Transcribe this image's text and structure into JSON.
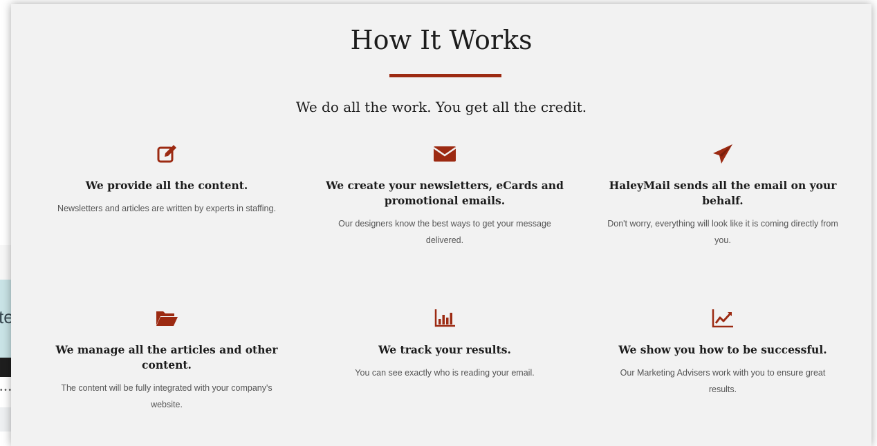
{
  "section": {
    "title": "How It Works",
    "subtitle": "We do all the work. You get all the credit."
  },
  "colors": {
    "accent": "#9c2a12",
    "panel_bg": "#f2f2f2",
    "text": "#1c1c1c"
  },
  "background_page": {
    "partial_text": "te"
  },
  "features": [
    {
      "icon": "edit-icon",
      "heading": "We provide all the content.",
      "description": "Newsletters and articles are written by experts in staffing."
    },
    {
      "icon": "envelope-icon",
      "heading": "We create your newsletters, eCards and promotional emails.",
      "description": "Our designers know the best ways to get your message delivered."
    },
    {
      "icon": "paper-plane-icon",
      "heading": "HaleyMail sends all the email on your behalf.",
      "description": "Don't worry, everything will look like it is coming directly from you."
    },
    {
      "icon": "folder-open-icon",
      "heading": "We manage all the articles and other content.",
      "description": "The content will be fully integrated with your company's website."
    },
    {
      "icon": "bar-chart-icon",
      "heading": "We track your results.",
      "description": "You can see exactly who is reading your email."
    },
    {
      "icon": "line-chart-icon",
      "heading": "We show you how to be successful.",
      "description": "Our Marketing Advisers work with you to ensure great results."
    }
  ]
}
